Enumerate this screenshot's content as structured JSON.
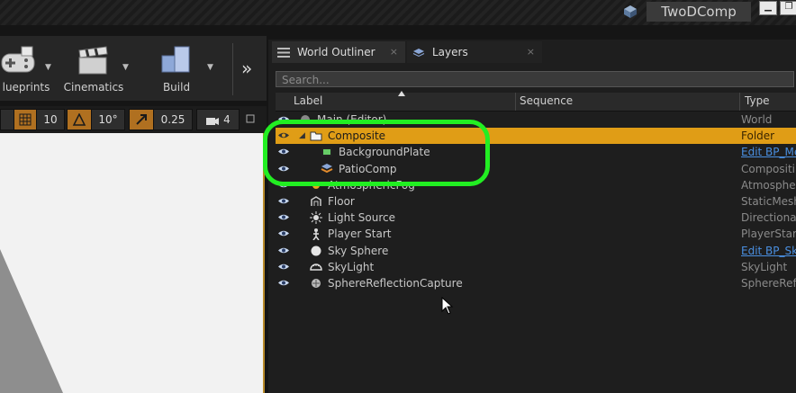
{
  "title_bar": {
    "project_name": "TwoDComp",
    "minimize_glyph": "▁",
    "maximize_glyph": "❐"
  },
  "toolbar": {
    "buttons": [
      {
        "label": "lueprints",
        "icon": "gamepad-icon"
      },
      {
        "label": "Cinematics",
        "icon": "clapperboard-icon"
      },
      {
        "label": "Build",
        "icon": "build-blocks-icon"
      }
    ],
    "more_glyph": "»"
  },
  "viewport_bar": {
    "grid_snap_value": "10",
    "rotation_snap_value": "10°",
    "scale_snap_value": "0.25",
    "camera_speed_value": "4"
  },
  "panel": {
    "tabs": [
      {
        "label": "World Outliner",
        "active": true,
        "close": "×"
      },
      {
        "label": "Layers",
        "active": false,
        "close": "×"
      }
    ],
    "search_placeholder": "Search...",
    "columns": {
      "label": "Label",
      "sequence": "Sequence",
      "type": "Type"
    },
    "rows": [
      {
        "name": "Main (Editor)",
        "type": "World",
        "indent": 0,
        "icon": "world-icon"
      },
      {
        "name": "Composite",
        "type": "Folder",
        "indent": 1,
        "icon": "folder-icon",
        "selected": true,
        "expanded": true
      },
      {
        "name": "BackgroundPlate",
        "type": "Edit BP_Me",
        "indent": 2,
        "icon": "film-plate-icon",
        "type_link": true
      },
      {
        "name": "PatioComp",
        "type": "Compositin",
        "indent": 2,
        "icon": "layers-stack-icon"
      },
      {
        "name": "AtmosphericFog",
        "type": "Atmospheri",
        "indent": 1,
        "icon": "fog-icon"
      },
      {
        "name": "Floor",
        "type": "StaticMesh",
        "indent": 1,
        "icon": "mesh-icon"
      },
      {
        "name": "Light Source",
        "type": "DirectionalL",
        "indent": 1,
        "icon": "light-icon"
      },
      {
        "name": "Player Start",
        "type": "PlayerStart",
        "indent": 1,
        "icon": "player-start-icon"
      },
      {
        "name": "Sky Sphere",
        "type": "Edit BP_Sk",
        "indent": 1,
        "icon": "sphere-icon",
        "type_link": true
      },
      {
        "name": "SkyLight",
        "type": "SkyLight",
        "indent": 1,
        "icon": "skylight-icon"
      },
      {
        "name": "SphereReflectionCapture",
        "type": "SphereRefle",
        "indent": 1,
        "icon": "reflection-capture-icon"
      }
    ]
  },
  "colors": {
    "selection": "#e09d16",
    "highlight_ring": "#22ee22",
    "link": "#4a8fe0",
    "viewport_border": "#b88a2a"
  }
}
